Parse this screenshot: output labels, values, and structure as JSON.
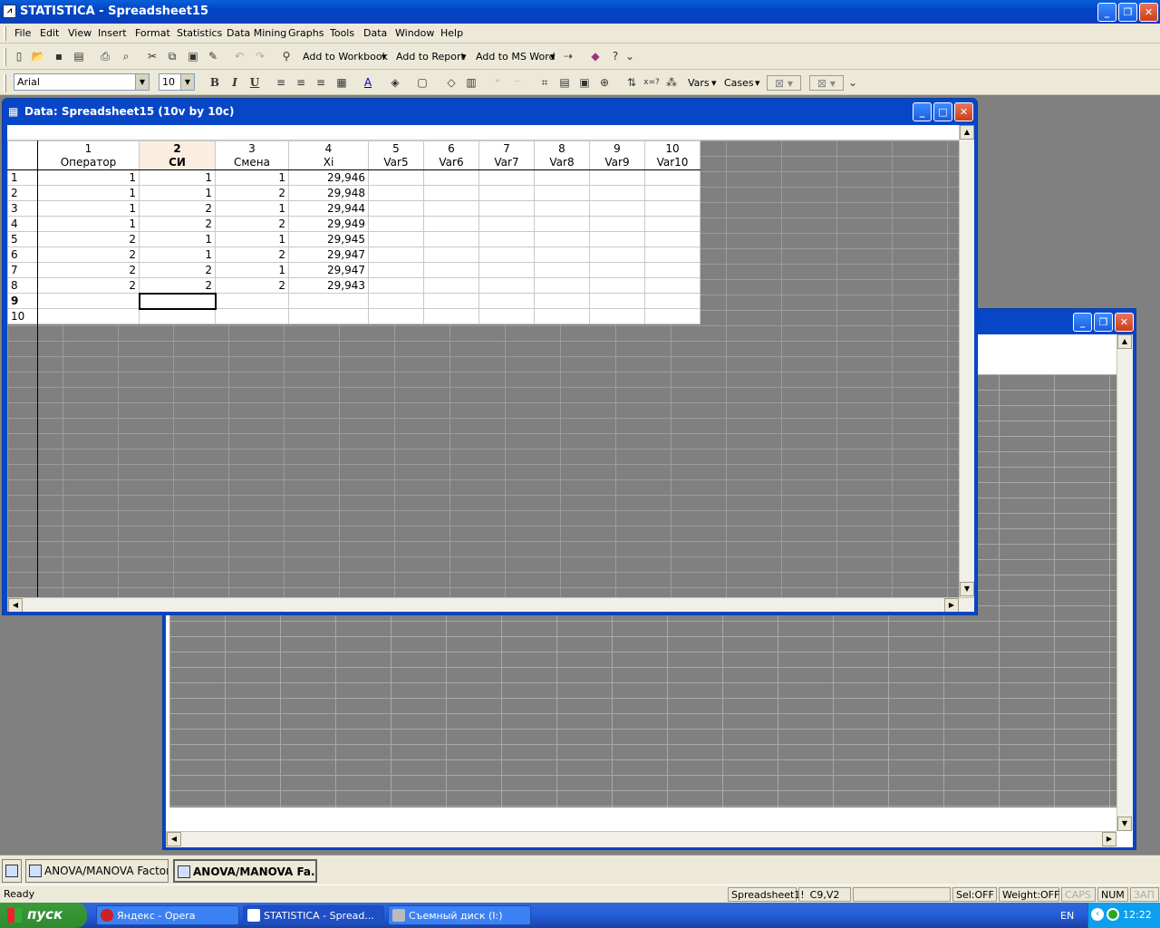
{
  "app": {
    "title": "STATISTICA - Spreadsheet15",
    "icon": "statistica-icon"
  },
  "menu": [
    "File",
    "Edit",
    "View",
    "Insert",
    "Format",
    "Statistics",
    "Data Mining",
    "Graphs",
    "Tools",
    "Data",
    "Window",
    "Help"
  ],
  "toolbar1": {
    "add_workbook": "Add to Workbook",
    "add_report": "Add to Report",
    "add_msword": "Add to MS Word"
  },
  "toolbar2": {
    "font": "Arial",
    "size": "10",
    "bold": "B",
    "italic": "I",
    "underline": "U",
    "vars": "Vars",
    "cases": "Cases"
  },
  "spreadsheet": {
    "title": "Data: Spreadsheet15 (10v by 10c)",
    "columns": [
      {
        "num": "1",
        "name": "Оператор"
      },
      {
        "num": "2",
        "name": "СИ"
      },
      {
        "num": "3",
        "name": "Смена"
      },
      {
        "num": "4",
        "name": "Xi"
      },
      {
        "num": "5",
        "name": "Var5"
      },
      {
        "num": "6",
        "name": "Var6"
      },
      {
        "num": "7",
        "name": "Var7"
      },
      {
        "num": "8",
        "name": "Var8"
      },
      {
        "num": "9",
        "name": "Var9"
      },
      {
        "num": "10",
        "name": "Var10"
      }
    ],
    "rows": [
      {
        "n": "1",
        "c": [
          "1",
          "1",
          "1",
          "29,946"
        ]
      },
      {
        "n": "2",
        "c": [
          "1",
          "1",
          "2",
          "29,948"
        ]
      },
      {
        "n": "3",
        "c": [
          "1",
          "2",
          "1",
          "29,944"
        ]
      },
      {
        "n": "4",
        "c": [
          "1",
          "2",
          "2",
          "29,949"
        ]
      },
      {
        "n": "5",
        "c": [
          "2",
          "1",
          "1",
          "29,945"
        ]
      },
      {
        "n": "6",
        "c": [
          "2",
          "1",
          "2",
          "29,947"
        ]
      },
      {
        "n": "7",
        "c": [
          "2",
          "2",
          "1",
          "29,947"
        ]
      },
      {
        "n": "8",
        "c": [
          "2",
          "2",
          "2",
          "29,943"
        ]
      },
      {
        "n": "9",
        "c": [
          "",
          "",
          "",
          ""
        ]
      },
      {
        "n": "10",
        "c": [
          "",
          "",
          "",
          ""
        ]
      }
    ]
  },
  "app_taskbar": [
    "ANOVA/MANOVA Factori...",
    "ANOVA/MANOVA Fa..."
  ],
  "status": {
    "ready": "Ready",
    "sheet": "Spreadsheet1!",
    "cell": "C9,V2",
    "sel": "Sel:OFF",
    "weight": "Weight:OFF",
    "caps": "CAPS",
    "num": "NUM",
    "scrl": "ЗАП"
  },
  "xp_taskbar": {
    "start": "пуск",
    "tabs": [
      "Яндекс - Opera",
      "STATISTICA - Spread...",
      "Съемный диск (I:)"
    ],
    "lang": "EN",
    "time": "12:22"
  }
}
